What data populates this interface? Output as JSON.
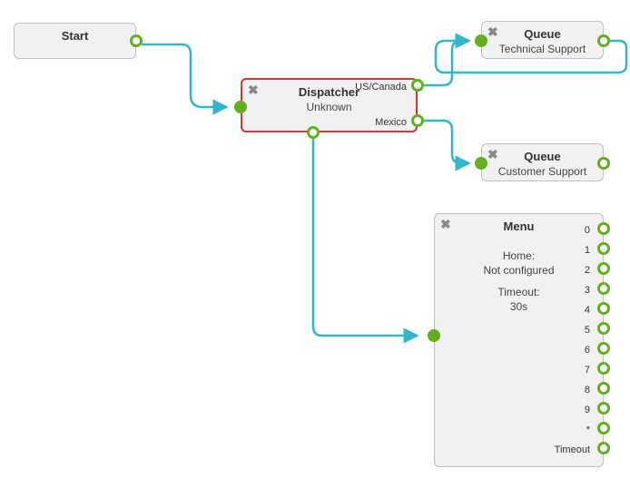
{
  "nodes": {
    "start": {
      "title": "Start"
    },
    "dispatcher": {
      "title": "Dispatcher",
      "subtitle": "Unknown",
      "out1_label": "US/Canada",
      "out2_label": "Mexico"
    },
    "queue1": {
      "title": "Queue",
      "subtitle": "Technical Support"
    },
    "queue2": {
      "title": "Queue",
      "subtitle": "Customer Support"
    },
    "menu": {
      "title": "Menu",
      "home_label": "Home:",
      "home_value": "Not configured",
      "timeout_label": "Timeout:",
      "timeout_value": "30s",
      "rows": {
        "r0": "0",
        "r1": "1",
        "r2": "2",
        "r3": "3",
        "r4": "4",
        "r5": "5",
        "r6": "6",
        "r7": "7",
        "r8": "8",
        "r9": "9",
        "r10": "*",
        "r11": "Timeout"
      }
    }
  }
}
